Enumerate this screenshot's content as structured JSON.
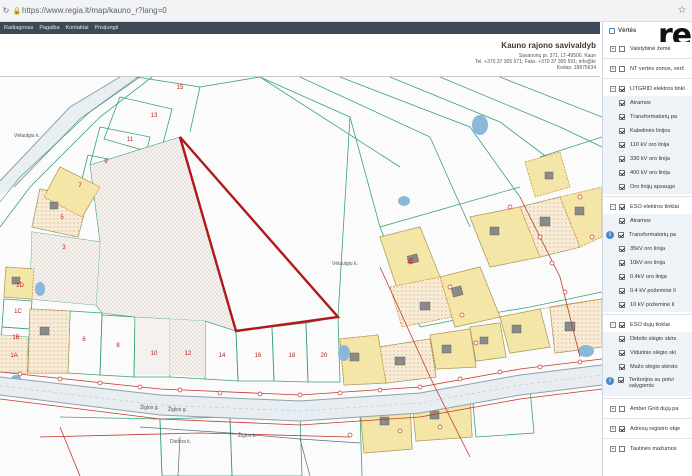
{
  "browser": {
    "url_host": "https://www.regia.lt",
    "url_path": "/map/kauno_r?lang=0"
  },
  "header": {
    "menu": [
      "Radiagonas",
      "Pagalba",
      "Kontaktai",
      "Prisijungti"
    ],
    "site_title": "Kauno rajono savivaldyb",
    "address_line1": "Savanorių pr. 371, LT-49500, Kaun",
    "address_line2": "Tel. +370 37 305 571; Faks. +370 37 305 591; info@kr",
    "address_line3": "Kodas: 18875634"
  },
  "map": {
    "plot_labels": [
      "15",
      "13",
      "11",
      "9",
      "7",
      "5",
      "3",
      "1D",
      "1C",
      "1B",
      "1A",
      "6",
      "8",
      "10",
      "12",
      "14",
      "16",
      "18",
      "20",
      "1E"
    ],
    "street_labels": [
      "Vėlaulgiu k.",
      "Žiglos g.",
      "Žiglos g.",
      "Vėlaulgiu k.",
      "Žiglos k.",
      "Dieboa k."
    ]
  },
  "layers": {
    "panel_title": "Vėrtės",
    "brand": "re",
    "items": [
      {
        "label": "Valstybinė žemė",
        "type": "group",
        "checked": false,
        "expander": "+"
      },
      {
        "label": "NT vertės zonos, verč",
        "type": "group",
        "checked": false,
        "expander": "+"
      },
      {
        "label": "LITGRID elektros tinkl",
        "type": "group",
        "checked": true,
        "expander": "−"
      },
      {
        "label": "Atramos",
        "type": "sub",
        "checked": true
      },
      {
        "label": "Transformatorių pa",
        "type": "sub",
        "checked": true
      },
      {
        "label": "Kabelinės linijos",
        "type": "sub",
        "checked": true
      },
      {
        "label": "110 kV oro linija",
        "type": "sub",
        "checked": true
      },
      {
        "label": "330 kV oro linija",
        "type": "sub",
        "checked": true
      },
      {
        "label": "400 kV oro linija",
        "type": "sub",
        "checked": true
      },
      {
        "label": "Oro linijų apsaugo",
        "type": "sub",
        "checked": true
      },
      {
        "label": "ESO elektros tinklai",
        "type": "group",
        "checked": true,
        "expander": "−"
      },
      {
        "label": "Atramos",
        "type": "sub",
        "checked": true
      },
      {
        "label": "Transformatorių pa",
        "type": "sub",
        "checked": true,
        "info": true
      },
      {
        "label": "35kV oro linija",
        "type": "sub",
        "checked": true
      },
      {
        "label": "10kV oro linija",
        "type": "sub",
        "checked": true
      },
      {
        "label": "0.4kV oro linija",
        "type": "sub",
        "checked": true
      },
      {
        "label": "0.4 kV požeminė li",
        "type": "sub",
        "checked": true
      },
      {
        "label": "10 kV požeminė li",
        "type": "sub",
        "checked": true
      },
      {
        "label": "ESO dujų tinklai",
        "type": "group",
        "checked": true,
        "expander": "−"
      },
      {
        "label": "Didelio slėgio skirs",
        "type": "sub",
        "checked": true
      },
      {
        "label": "Vidutinio slėgio ski",
        "type": "sub",
        "checked": true
      },
      {
        "label": "Mažo slėgio skirsto",
        "type": "sub",
        "checked": true
      },
      {
        "label": "Teritorijos su potvi",
        "label2": "salygomis",
        "type": "sub",
        "checked": true,
        "info": true
      },
      {
        "label": "Amber Grid dujų pa",
        "type": "group",
        "checked": false,
        "expander": "+"
      },
      {
        "label": "Adresų registro obje",
        "type": "group",
        "checked": false,
        "expander": "+"
      },
      {
        "label": "Tautinės mažumos",
        "type": "group",
        "checked": false,
        "expander": "+"
      }
    ]
  },
  "colors": {
    "plot_line": "#3aa17a",
    "highlight": "#b0181c",
    "building": "#f3e6a6",
    "road": "#8fa1ae",
    "water": "#8ab8d8"
  }
}
